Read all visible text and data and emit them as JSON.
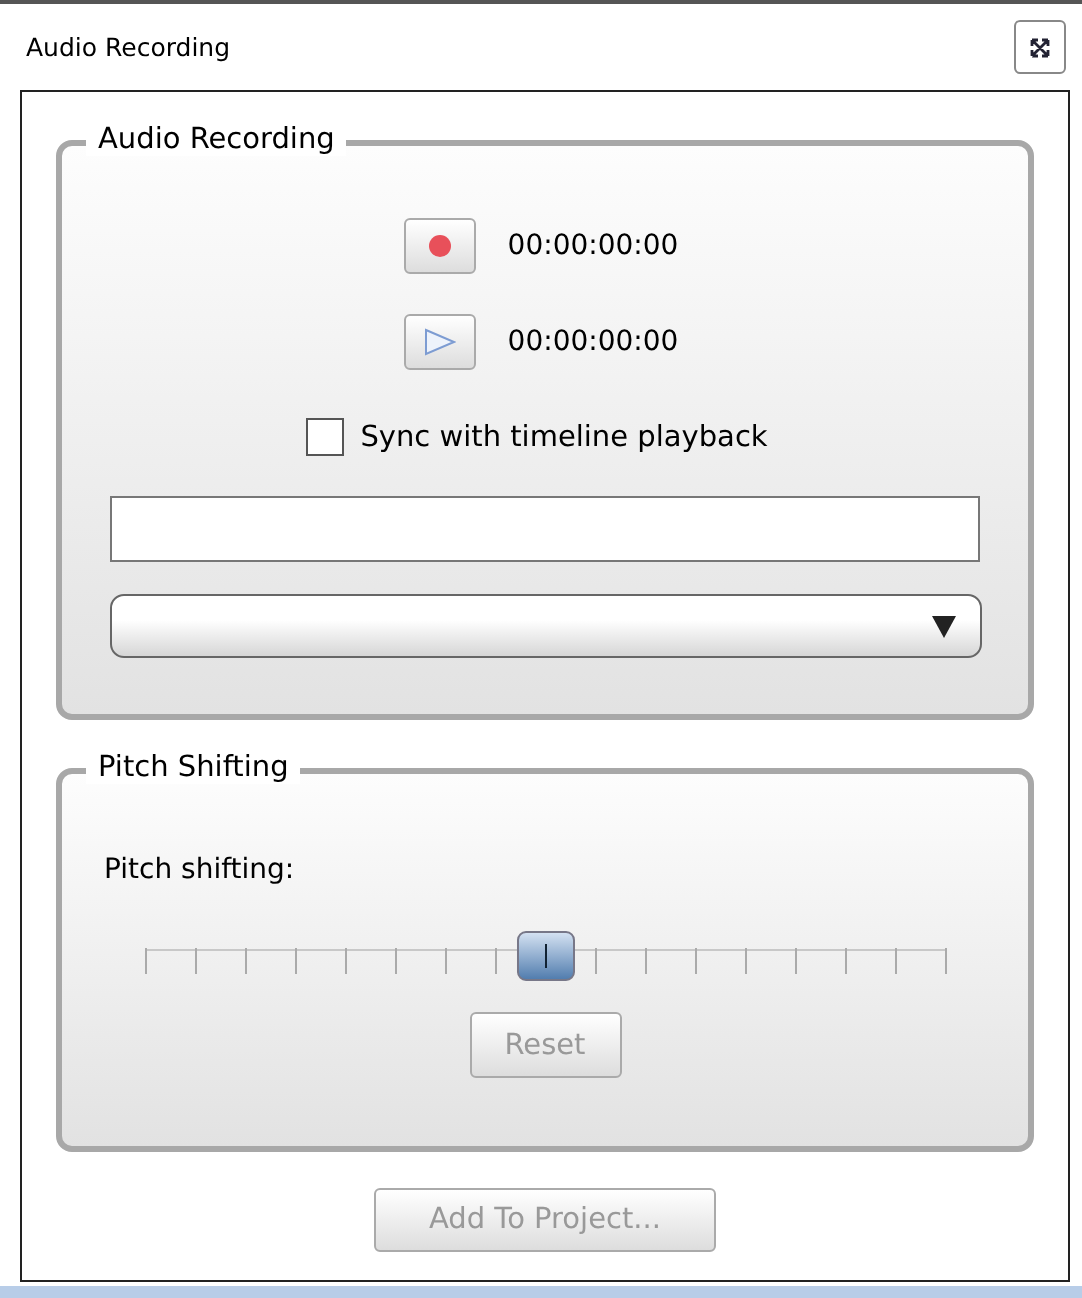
{
  "window": {
    "title": "Audio Recording"
  },
  "recording": {
    "title": "Audio Recording",
    "transport": [
      {
        "kind": "record",
        "time": "00:00:00:00"
      },
      {
        "kind": "play",
        "time": "00:00:00:00"
      }
    ],
    "sync": {
      "label": "Sync with timeline playback",
      "checked": false
    }
  },
  "pitch": {
    "title": "Pitch Shifting",
    "label": "Pitch shifting:",
    "level": 0.5,
    "reset": {
      "label": "Reset",
      "disabled": true
    }
  },
  "add_button": {
    "label": "Add To Project...",
    "disabled": true
  }
}
